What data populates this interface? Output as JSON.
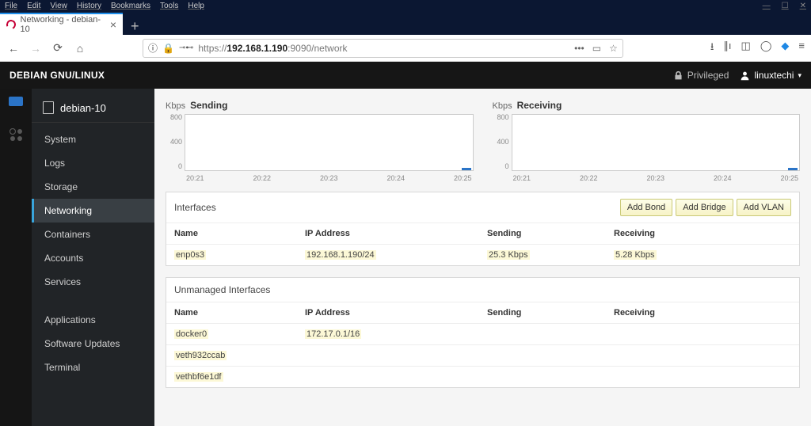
{
  "browser": {
    "menu": [
      "File",
      "Edit",
      "View",
      "History",
      "Bookmarks",
      "Tools",
      "Help"
    ],
    "tab_title": "Networking - debian-10",
    "url_pre": "https://",
    "url_host": "192.168.1.190",
    "url_post": ":9090/network"
  },
  "header": {
    "brand": "DEBIAN GNU/LINUX",
    "priv": "Privileged",
    "user": "linuxtechi"
  },
  "sidebar": {
    "host": "debian-10",
    "items": [
      "System",
      "Logs",
      "Storage",
      "Networking",
      "Containers",
      "Accounts",
      "Services"
    ],
    "extra": [
      "Applications",
      "Software Updates",
      "Terminal"
    ],
    "active": "Networking"
  },
  "charts": {
    "unit": "Kbps",
    "send_title": "Sending",
    "recv_title": "Receiving",
    "yticks": [
      "800",
      "400",
      "0"
    ],
    "xticks": [
      "20:21",
      "20:22",
      "20:23",
      "20:24",
      "20:25"
    ]
  },
  "interfaces": {
    "title": "Interfaces",
    "buttons": [
      "Add Bond",
      "Add Bridge",
      "Add VLAN"
    ],
    "cols": [
      "Name",
      "IP Address",
      "Sending",
      "Receiving"
    ],
    "rows": [
      {
        "name": "enp0s3",
        "ip": "192.168.1.190/24",
        "snd": "25.3 Kbps",
        "rcv": "5.28 Kbps"
      }
    ]
  },
  "unmanaged": {
    "title": "Unmanaged Interfaces",
    "cols": [
      "Name",
      "IP Address",
      "Sending",
      "Receiving"
    ],
    "rows": [
      {
        "name": "docker0",
        "ip": "172.17.0.1/16",
        "snd": "",
        "rcv": ""
      },
      {
        "name": "veth932ccab",
        "ip": "",
        "snd": "",
        "rcv": ""
      },
      {
        "name": "vethbf6e1df",
        "ip": "",
        "snd": "",
        "rcv": ""
      }
    ]
  },
  "chart_data": [
    {
      "type": "line",
      "title": "Sending",
      "ylabel": "Kbps",
      "ylim": [
        0,
        800
      ],
      "x": [
        "20:21",
        "20:22",
        "20:23",
        "20:24",
        "20:25"
      ],
      "values": [
        0,
        0,
        0,
        0,
        5
      ]
    },
    {
      "type": "line",
      "title": "Receiving",
      "ylabel": "Kbps",
      "ylim": [
        0,
        800
      ],
      "x": [
        "20:21",
        "20:22",
        "20:23",
        "20:24",
        "20:25"
      ],
      "values": [
        0,
        0,
        0,
        0,
        3
      ]
    }
  ]
}
